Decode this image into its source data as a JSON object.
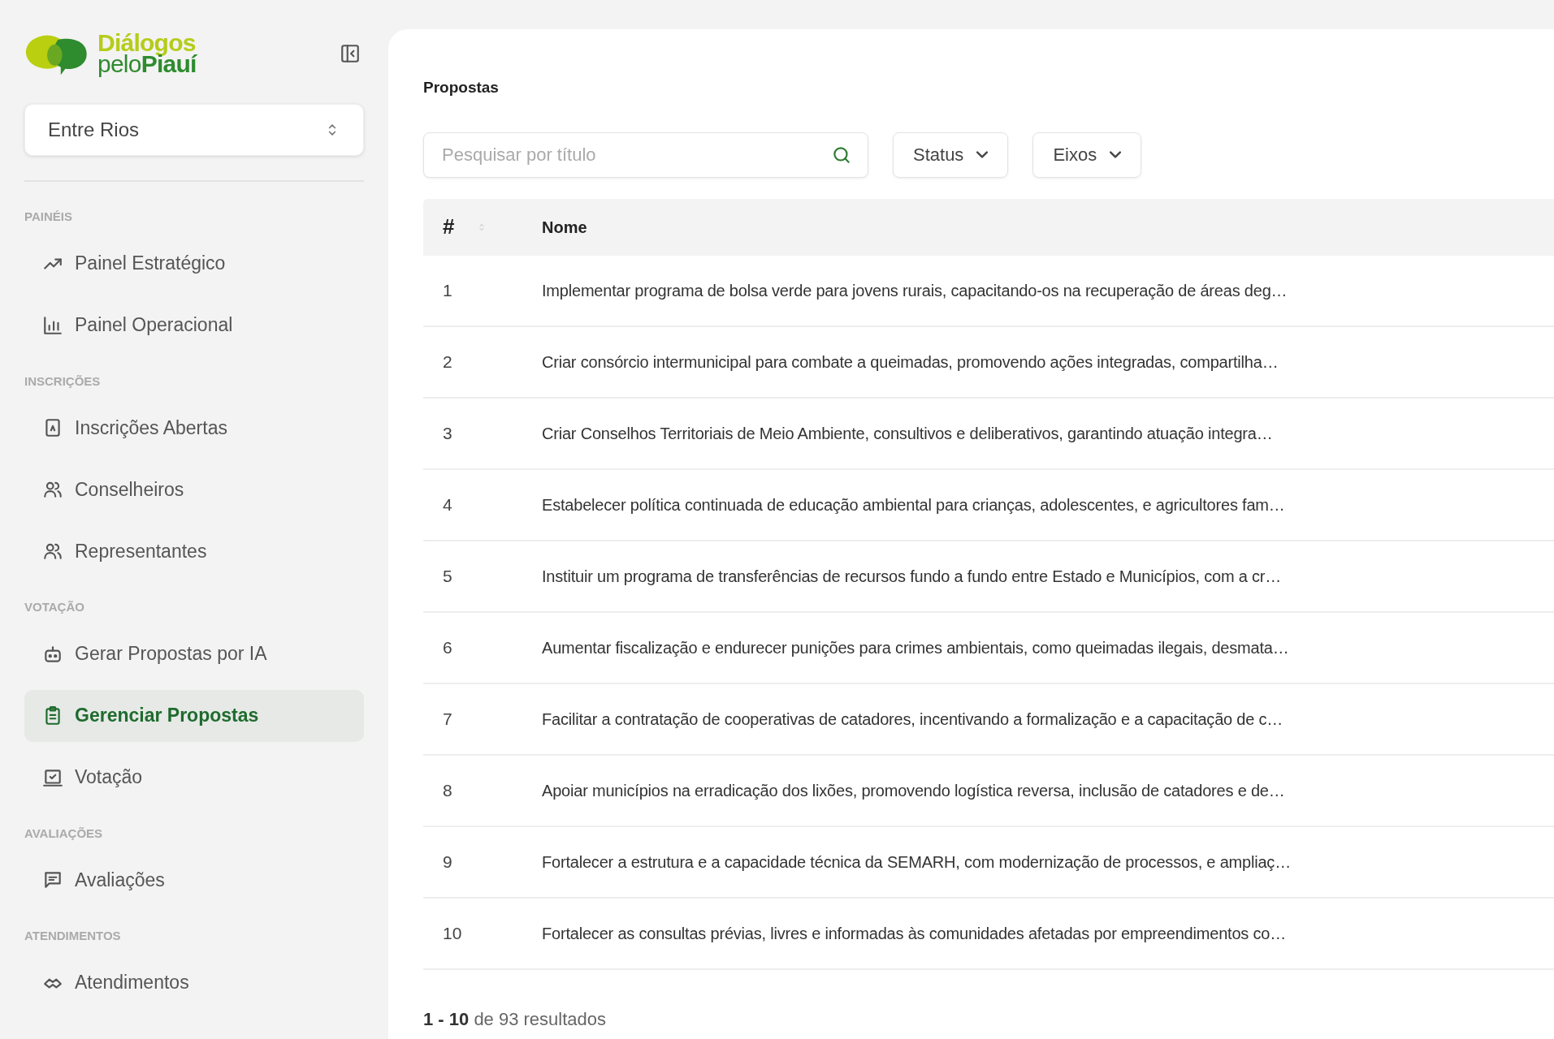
{
  "logo": {
    "title": "Diálogos",
    "subtitle": "pelo**Piauí**"
  },
  "location_select": {
    "value": "Entre Rios"
  },
  "sidebar": {
    "sections": [
      {
        "label": "PAINÉIS",
        "items": [
          {
            "label": "Painel Estratégico",
            "selected": false
          },
          {
            "label": "Painel Operacional",
            "selected": false
          }
        ]
      },
      {
        "label": "INSCRIÇÕES",
        "items": [
          {
            "label": "Inscrições Abertas",
            "selected": false
          },
          {
            "label": "Conselheiros",
            "selected": false
          },
          {
            "label": "Representantes",
            "selected": false
          }
        ]
      },
      {
        "label": "VOTAÇÃO",
        "items": [
          {
            "label": "Gerar Propostas por IA",
            "selected": false
          },
          {
            "label": "Gerenciar Propostas",
            "selected": true
          },
          {
            "label": "Votação",
            "selected": false
          }
        ]
      },
      {
        "label": "AVALIAÇÕES",
        "items": [
          {
            "label": "Avaliações",
            "selected": false
          }
        ]
      },
      {
        "label": "ATENDIMENTOS",
        "items": [
          {
            "label": "Atendimentos",
            "selected": false
          }
        ]
      }
    ]
  },
  "page_title": "Propostas",
  "search": {
    "placeholder": "Pesquisar por título"
  },
  "filters": [
    "Status",
    "Eixos"
  ],
  "table": {
    "columns": [
      "#",
      "Nome"
    ],
    "rows": [
      [
        "1",
        "Implementar programa de bolsa verde para jovens rurais, capacitando-os na recuperação de áreas deg…"
      ],
      [
        "2",
        "Criar consórcio intermunicipal para combate a queimadas, promovendo ações integradas, compartilha…"
      ],
      [
        "3",
        "Criar Conselhos Territoriais de Meio Ambiente, consultivos e deliberativos, garantindo atuação integra…"
      ],
      [
        "4",
        "Estabelecer política continuada de educação ambiental para crianças, adolescentes, e agricultores fam…"
      ],
      [
        "5",
        "Instituir um programa de transferências de recursos fundo a fundo entre Estado e Municípios, com a cr…"
      ],
      [
        "6",
        "Aumentar fiscalização e endurecer punições para crimes ambientais, como queimadas ilegais, desmata…"
      ],
      [
        "7",
        "Facilitar a contratação de cooperativas de catadores, incentivando a formalização e a capacitação de c…"
      ],
      [
        "8",
        "Apoiar municípios na erradicação dos lixões, promovendo logística reversa, inclusão de catadores e de…"
      ],
      [
        "9",
        "Fortalecer a estrutura e a capacidade técnica da SEMARH, com modernização de processos, e ampliaç…"
      ],
      [
        "10",
        "Fortalecer as consultas prévias, livres e informadas às comunidades afetadas por empreendimentos co…"
      ]
    ]
  },
  "pagination": "**1 - 10** de 93 resultados"
}
